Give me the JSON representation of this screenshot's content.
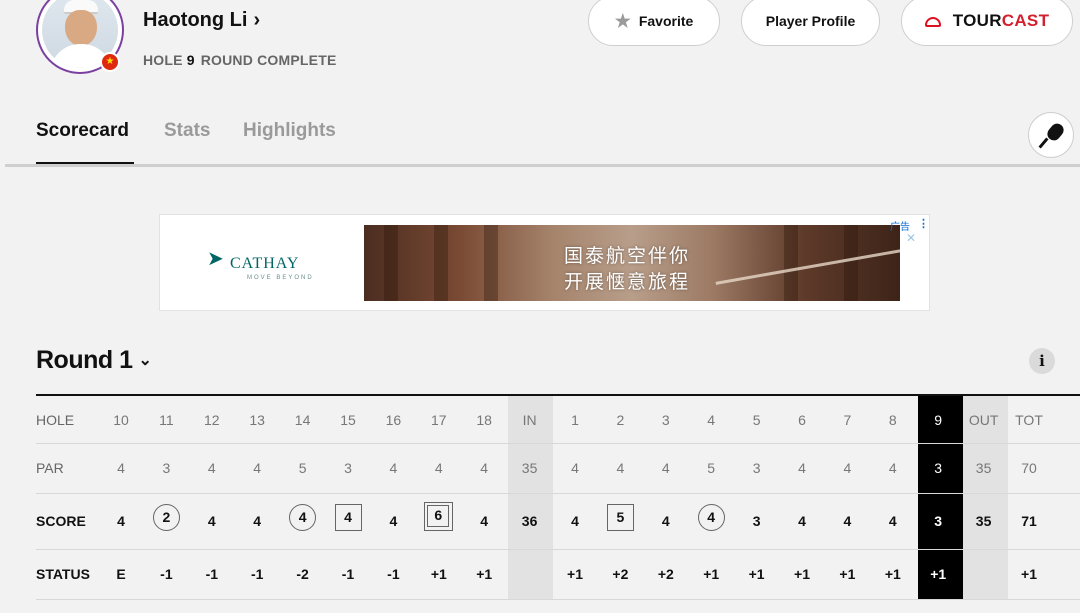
{
  "header": {
    "player_name": "Haotong Li",
    "name_chevron": "›",
    "hole_label": "HOLE",
    "hole_number": "9",
    "round_status": "ROUND COMPLETE",
    "flag_glyph": "★",
    "favorite_label": "Favorite",
    "favorite_icon": "★",
    "profile_label": "Player Profile",
    "tourcast_tour": "TOUR",
    "tourcast_cast": "CAST",
    "accent_color": "#d3202e"
  },
  "tabs": [
    {
      "label": "Scorecard",
      "active": true
    },
    {
      "label": "Stats",
      "active": false
    },
    {
      "label": "Highlights",
      "active": false
    }
  ],
  "ad": {
    "brand": "CATHAY",
    "brand_mark": "➤",
    "tagline": "MOVE BEYOND",
    "line1": "国泰航空伴你",
    "line2": "开展惬意旅程",
    "ad_label": "广告",
    "menu_glyph": "⋮",
    "close_glyph": "✕"
  },
  "round": {
    "title": "Round 1",
    "chevron": "⌄",
    "info_glyph": "i"
  },
  "scorecard": {
    "row_labels": [
      "HOLE",
      "PAR",
      "SCORE",
      "STATUS"
    ],
    "columns": [
      {
        "hole": "10",
        "par": "4",
        "score": "4",
        "status": "E",
        "mark": "none"
      },
      {
        "hole": "11",
        "par": "3",
        "score": "2",
        "status": "-1",
        "mark": "circle"
      },
      {
        "hole": "12",
        "par": "4",
        "score": "4",
        "status": "-1",
        "mark": "none"
      },
      {
        "hole": "13",
        "par": "4",
        "score": "4",
        "status": "-1",
        "mark": "none"
      },
      {
        "hole": "14",
        "par": "5",
        "score": "4",
        "status": "-2",
        "mark": "circle"
      },
      {
        "hole": "15",
        "par": "3",
        "score": "4",
        "status": "-1",
        "mark": "square"
      },
      {
        "hole": "16",
        "par": "4",
        "score": "4",
        "status": "-1",
        "mark": "none"
      },
      {
        "hole": "17",
        "par": "4",
        "score": "6",
        "status": "+1",
        "mark": "double-square"
      },
      {
        "hole": "18",
        "par": "4",
        "score": "4",
        "status": "+1",
        "mark": "none"
      },
      {
        "hole": "IN",
        "par": "35",
        "score": "36",
        "status": "",
        "mark": "none",
        "kind": "total"
      },
      {
        "hole": "1",
        "par": "4",
        "score": "4",
        "status": "+1",
        "mark": "none"
      },
      {
        "hole": "2",
        "par": "4",
        "score": "5",
        "status": "+2",
        "mark": "square"
      },
      {
        "hole": "3",
        "par": "4",
        "score": "4",
        "status": "+2",
        "mark": "none"
      },
      {
        "hole": "4",
        "par": "5",
        "score": "4",
        "status": "+1",
        "mark": "circle"
      },
      {
        "hole": "5",
        "par": "3",
        "score": "3",
        "status": "+1",
        "mark": "none"
      },
      {
        "hole": "6",
        "par": "4",
        "score": "4",
        "status": "+1",
        "mark": "none"
      },
      {
        "hole": "7",
        "par": "4",
        "score": "4",
        "status": "+1",
        "mark": "none"
      },
      {
        "hole": "8",
        "par": "4",
        "score": "4",
        "status": "+1",
        "mark": "none"
      },
      {
        "hole": "9",
        "par": "3",
        "score": "3",
        "status": "+1",
        "mark": "none",
        "kind": "current"
      },
      {
        "hole": "OUT",
        "par": "35",
        "score": "35",
        "status": "",
        "mark": "none",
        "kind": "total"
      },
      {
        "hole": "TOT",
        "par": "70",
        "score": "71",
        "status": "+1",
        "mark": "none",
        "kind": "grand"
      }
    ]
  }
}
